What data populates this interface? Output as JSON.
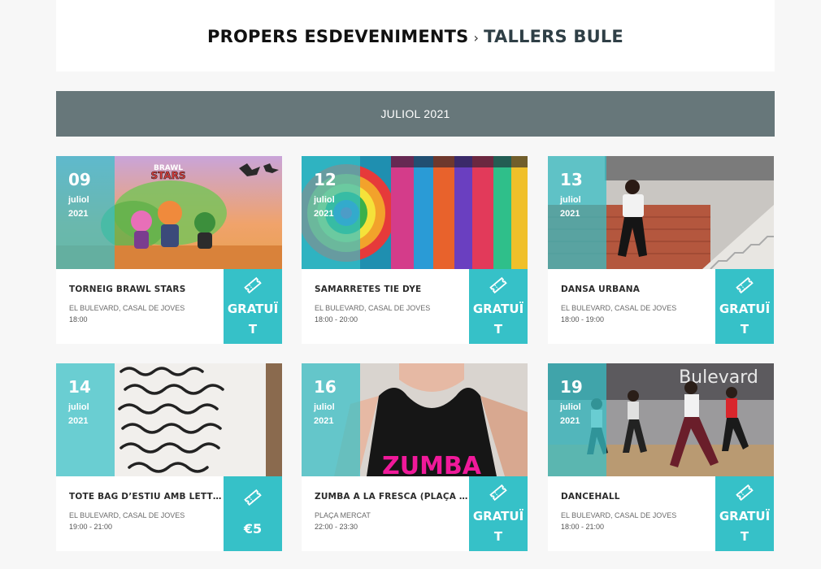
{
  "breadcrumb": {
    "parent": "PROPERS ESDEVENIMENTS",
    "separator": "›",
    "current": "TALLERS BULE"
  },
  "month": "JULIOL 2021",
  "colors": {
    "accent": "#36c1c8",
    "month_bar": "#67777a"
  },
  "events": [
    {
      "day": "09",
      "month": "juliol",
      "year": "2021",
      "title": "TORNEIG BRAWL STARS",
      "venue": "EL BULEVARD, CASAL DE JOVES",
      "time": "18:00",
      "price": "GRATUÏT",
      "icon": "ticket-icon",
      "image": "brawl-stars-image"
    },
    {
      "day": "12",
      "month": "juliol",
      "year": "2021",
      "title": "SAMARRETES TIE DYE",
      "venue": "EL BULEVARD, CASAL DE JOVES",
      "time": "18:00 - 20:00",
      "price": "GRATUÏT",
      "icon": "ticket-icon",
      "image": "tie-dye-shirts-image"
    },
    {
      "day": "13",
      "month": "juliol",
      "year": "2021",
      "title": "DANSA URBANA",
      "venue": "EL BULEVARD, CASAL DE JOVES",
      "time": "18:00 - 19:00",
      "price": "GRATUÏT",
      "icon": "ticket-icon",
      "image": "urban-dancer-image"
    },
    {
      "day": "14",
      "month": "juliol",
      "year": "2021",
      "title": "TOTE BAG D’ESTIU AMB LETTERING",
      "venue": "EL BULEVARD, CASAL DE JOVES",
      "time": "19:00 - 21:00",
      "price": "€5",
      "icon": "ticket-icon",
      "image": "lettering-tote-image"
    },
    {
      "day": "16",
      "month": "juliol",
      "year": "2021",
      "title": "ZUMBA A LA FRESCA (PLAÇA DEL MERCAT)",
      "venue": "PLAÇA MERCAT",
      "time": "22:00 - 23:30",
      "price": "GRATUÏT",
      "icon": "ticket-icon",
      "image": "zumba-image"
    },
    {
      "day": "19",
      "month": "juliol",
      "year": "2021",
      "title": "DANCEHALL",
      "venue": "EL BULEVARD, CASAL DE JOVES",
      "time": "18:00 - 21:00",
      "price": "GRATUÏT",
      "icon": "ticket-icon",
      "image": "dancehall-class-image"
    }
  ]
}
